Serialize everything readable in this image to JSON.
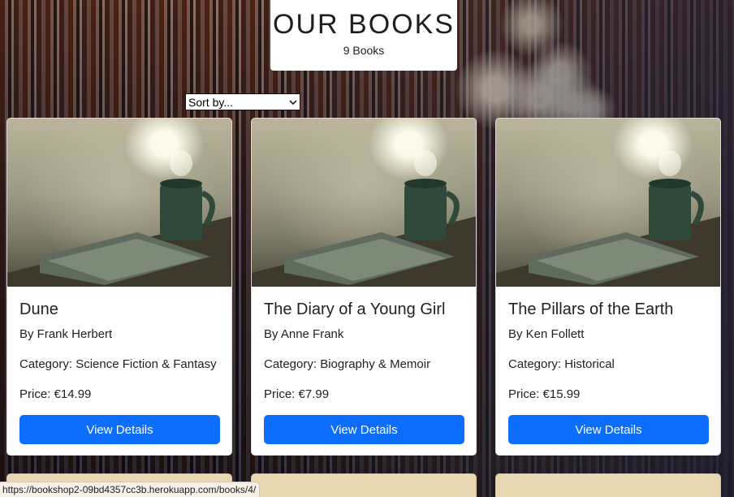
{
  "header": {
    "title": "OUR BOOKS",
    "count": "9 Books"
  },
  "sort": {
    "selected": "Sort by..."
  },
  "books": [
    {
      "title": "Dune",
      "author": "By Frank Herbert",
      "category": "Category: Science Fiction & Fantasy",
      "price": "Price: €14.99",
      "button": "View Details"
    },
    {
      "title": "The Diary of a Young Girl",
      "author": "By Anne Frank",
      "category": "Category: Biography & Memoir",
      "price": "Price: €7.99",
      "button": "View Details"
    },
    {
      "title": "The Pillars of the Earth",
      "author": "By Ken Follett",
      "category": "Category: Historical",
      "price": "Price: €15.99",
      "button": "View Details"
    }
  ],
  "status_bar": {
    "url": "https://bookshop2-09bd4357cc3b.herokuapp.com/books/4/"
  },
  "colors": {
    "button": "#0d6efd",
    "card_background": "#ffffff"
  },
  "icons": {
    "cover_image": "book-and-coffee-mug-image",
    "sort_chevron": "chevron-down-icon"
  }
}
